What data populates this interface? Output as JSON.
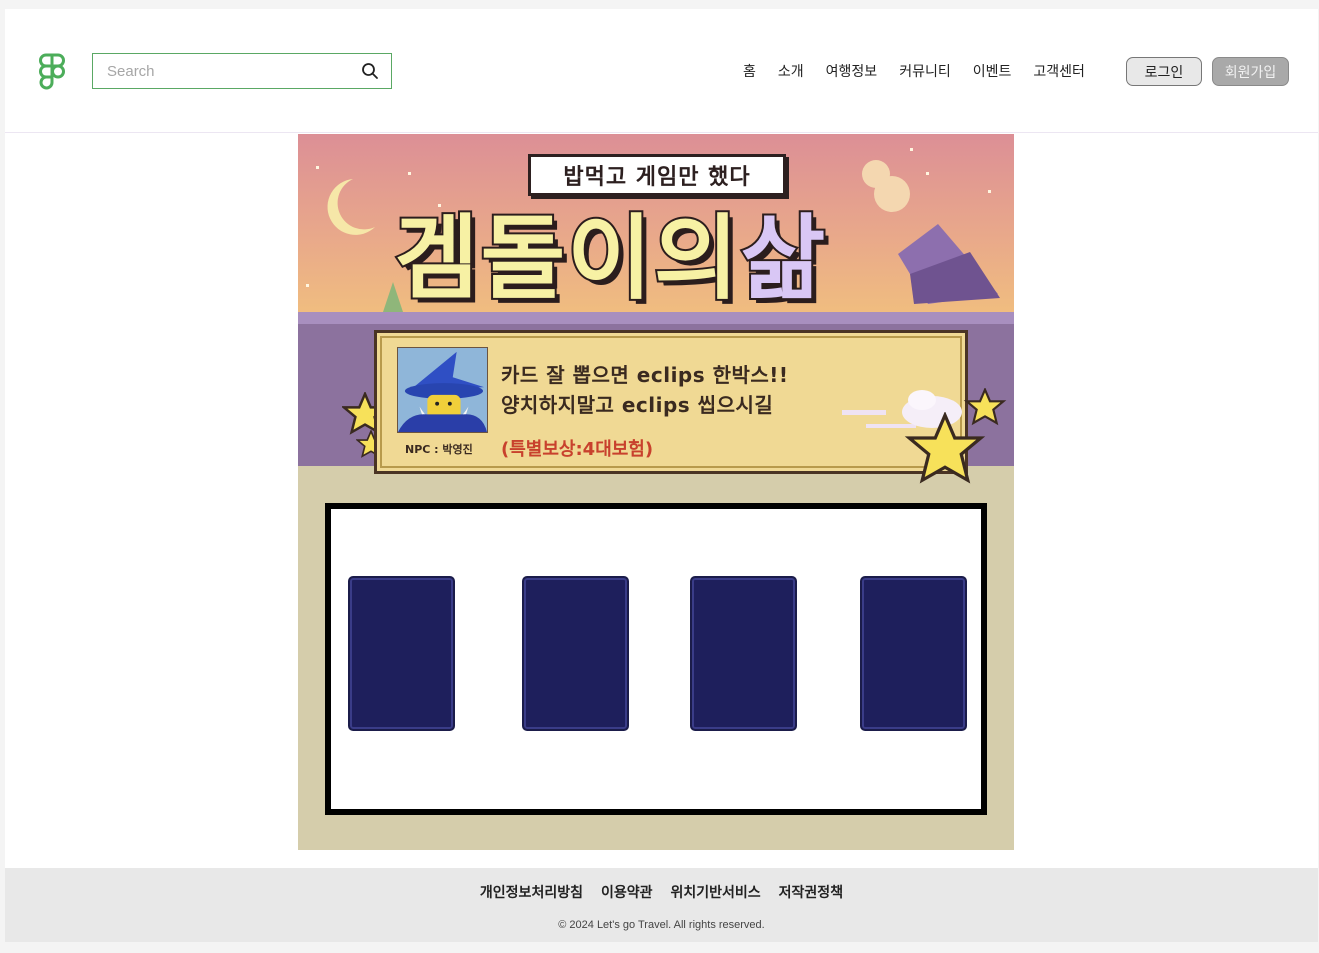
{
  "header": {
    "search_placeholder": "Search",
    "nav": [
      "홈",
      "소개",
      "여행정보",
      "커뮤니티",
      "이벤트",
      "고객센터"
    ],
    "login_label": "로그인",
    "signup_label": "회원가입"
  },
  "event": {
    "subtitle": "밥먹고 게임만 했다",
    "title_main": "겜돌이의",
    "title_last": "삶",
    "npc_label": "NPC : 박영진",
    "dialog_line1": "카드 잘 뽑으면 eclips 한박스!!",
    "dialog_line2": "양치하지말고 eclips 씹으시길",
    "reward": "(특별보상:4대보험)",
    "card_count": 4
  },
  "footer": {
    "links": [
      "개인정보처리방침",
      "이용약관",
      "위치기반서비스",
      "저작권정책"
    ],
    "copyright": "© 2024 Let's go Travel. All rights reserved."
  },
  "colors": {
    "accent_green": "#5aa864",
    "card_back": "#1e1f5c",
    "reward_red": "#c8412d"
  }
}
